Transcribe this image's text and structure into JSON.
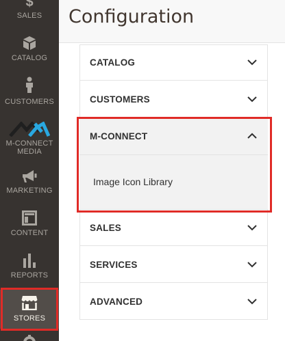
{
  "sidebar": {
    "items": [
      {
        "label": "SALES",
        "icon": "dollar-icon"
      },
      {
        "label": "CATALOG",
        "icon": "cube-icon"
      },
      {
        "label": "CUSTOMERS",
        "icon": "person-icon"
      },
      {
        "label_line1": "M-CONNECT",
        "label_line2": "MEDIA",
        "icon": "mconnect-logo-icon"
      },
      {
        "label": "MARKETING",
        "icon": "megaphone-icon"
      },
      {
        "label": "CONTENT",
        "icon": "layout-icon"
      },
      {
        "label": "REPORTS",
        "icon": "bar-chart-icon"
      },
      {
        "label": "STORES",
        "icon": "store-icon",
        "active": true
      }
    ]
  },
  "header": {
    "title": "Configuration"
  },
  "sections": [
    {
      "title": "CATALOG",
      "expanded": false
    },
    {
      "title": "CUSTOMERS",
      "expanded": false
    },
    {
      "title": "M-CONNECT",
      "expanded": true,
      "links": [
        "Image Icon Library"
      ]
    },
    {
      "title": "SALES",
      "expanded": false
    },
    {
      "title": "SERVICES",
      "expanded": false
    },
    {
      "title": "ADVANCED",
      "expanded": false
    }
  ],
  "colors": {
    "sidebar_bg": "#373330",
    "sidebar_active_bg": "#524d49",
    "highlight_red": "#e02b27",
    "title_text": "#41362f"
  }
}
